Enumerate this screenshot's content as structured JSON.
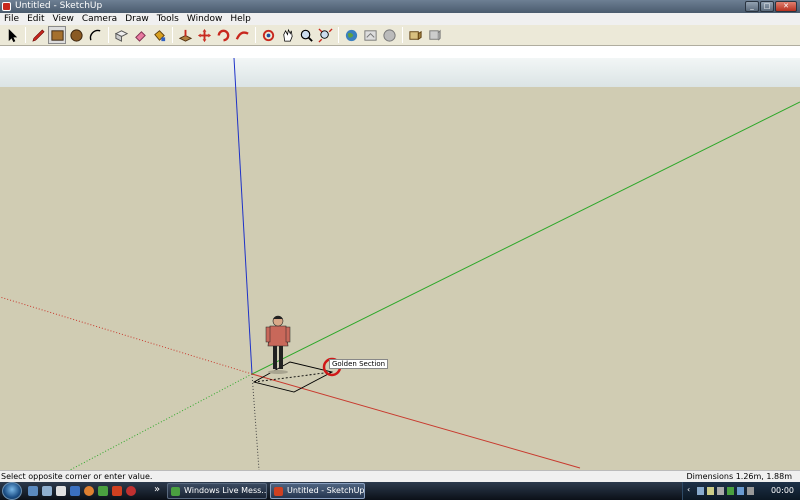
{
  "window": {
    "title": "Untitled - SketchUp",
    "min": "_",
    "max": "□",
    "close": "✕"
  },
  "menu": [
    "File",
    "Edit",
    "View",
    "Camera",
    "Draw",
    "Tools",
    "Window",
    "Help"
  ],
  "toolbar": {
    "tools": [
      "select-icon",
      "pencil-icon",
      "rectangle-icon",
      "circle-icon",
      "arc-icon",
      "eraser-icon",
      "paint-bucket-icon",
      "push-pull-icon",
      "move-icon",
      "rotate-icon",
      "follow-me-icon",
      "orbit-icon",
      "pan-icon",
      "zoom-icon",
      "zoom-extents-icon",
      "get-models-icon",
      "share-model-icon",
      "google-earth-icon",
      "component-icon",
      "share-component-icon"
    ]
  },
  "canvas": {
    "tooltip": "Golden Section",
    "axis_colors": {
      "red": "#c83a2e",
      "green": "#2ea82a",
      "blue": "#1e32c8"
    },
    "ground_color": "#d0ccb3",
    "sky_color": "#e6edee"
  },
  "statusbar": {
    "hint": "Select opposite corner or enter value.",
    "measurements": "Dimensions 1.26m, 1.88m"
  },
  "taskbar": {
    "buttons": [
      "Windows Live Mess...",
      "Untitled - SketchUp"
    ],
    "expand": "»",
    "clock": "00:00"
  }
}
